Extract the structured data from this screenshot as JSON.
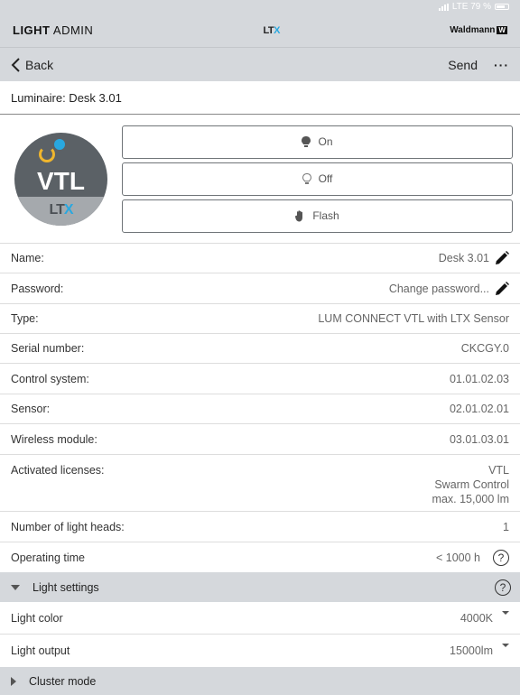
{
  "status_bar": {
    "network": "LTE 79 %"
  },
  "app_bar": {
    "title_bold": "LIGHT",
    "title_rest": " ADMIN",
    "logo_l": "LT",
    "logo_x": "X",
    "brand": "Waldmann",
    "brand_mark": "W"
  },
  "nav": {
    "back_label": "Back",
    "send_label": "Send",
    "more_label": "···"
  },
  "luminaire_label": "Luminaire: Desk 3.01",
  "badge": {
    "main": "VTL",
    "sub_l": "LT",
    "sub_x": "X"
  },
  "actions": [
    {
      "label": "On",
      "icon": "bulb-filled-icon"
    },
    {
      "label": "Off",
      "icon": "bulb-outline-icon"
    },
    {
      "label": "Flash",
      "icon": "hand-icon"
    }
  ],
  "details": {
    "name": {
      "label": "Name:",
      "value": "Desk 3.01"
    },
    "password": {
      "label": "Password:",
      "value": "Change password..."
    },
    "type": {
      "label": "Type:",
      "value": "LUM CONNECT VTL with LTX Sensor"
    },
    "serial": {
      "label": "Serial number:",
      "value": "CKCGY.0"
    },
    "control": {
      "label": "Control system:",
      "value": "01.01.02.03"
    },
    "sensor": {
      "label": "Sensor:",
      "value": "02.01.02.01"
    },
    "wireless": {
      "label": "Wireless module:",
      "value": "03.01.03.01"
    },
    "licenses": {
      "label": "Activated licenses:",
      "values": [
        "VTL",
        "Swarm Control",
        "max. 15,000 lm"
      ]
    },
    "heads": {
      "label": "Number of light heads:",
      "value": "1"
    },
    "operating": {
      "label": "Operating time",
      "value": "< 1000 h"
    }
  },
  "light_settings": {
    "title": "Light settings",
    "help": "?",
    "color": {
      "label": "Light color",
      "value": "4000K"
    },
    "output": {
      "label": "Light output",
      "value": "15000lm"
    }
  },
  "cluster_mode": {
    "title": "Cluster mode"
  },
  "colors": {
    "accent": "#29a8e0",
    "ring": "#f0b62d",
    "bar": "#d5d8dc"
  }
}
